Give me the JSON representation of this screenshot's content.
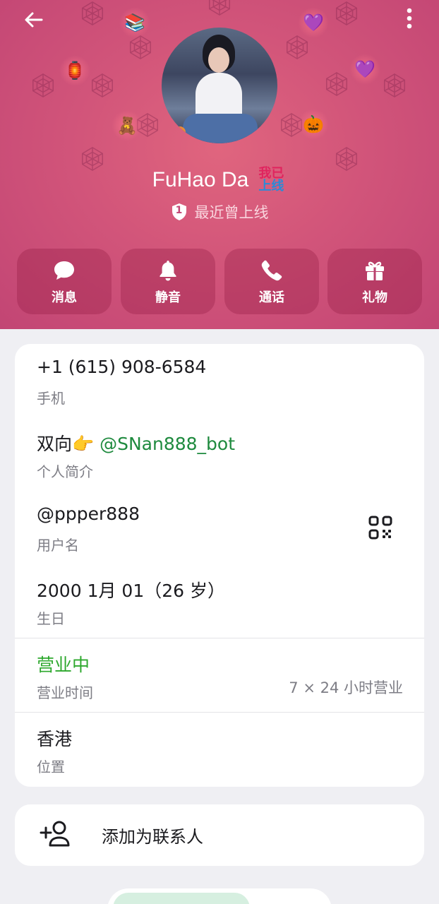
{
  "header": {
    "name": "FuHao Da",
    "emoji_status_line1": "我已",
    "emoji_status_line2": "上线",
    "level_badge": "1",
    "last_seen": "最近曾上线",
    "background_color": "#d2557a"
  },
  "actions": [
    {
      "label": "消息",
      "icon": "message-bubble-icon"
    },
    {
      "label": "静音",
      "icon": "bell-icon"
    },
    {
      "label": "通话",
      "icon": "phone-icon"
    },
    {
      "label": "礼物",
      "icon": "gift-icon"
    }
  ],
  "info": {
    "phone": {
      "value": "+1 (615) 908-6584",
      "label": "手机"
    },
    "bio": {
      "prefix": "双向",
      "emoji": "👉",
      "link": "@SNan888_bot",
      "label": "个人简介"
    },
    "username": {
      "value": "@ppper888",
      "label": "用户名"
    },
    "birthday": {
      "value": "2000 1月 01（26 岁）",
      "label": "生日"
    },
    "business_hours": {
      "status": "营业中",
      "label": "营业时间",
      "value": "7 × 24 小时营业"
    },
    "location": {
      "value": "香港",
      "label": "位置"
    }
  },
  "add_contact": {
    "label": "添加为联系人"
  },
  "colors": {
    "accent_green": "#2ea82e",
    "link_green": "#1e8a3e",
    "card_bg": "#ffffff",
    "page_bg": "#efeff3"
  }
}
